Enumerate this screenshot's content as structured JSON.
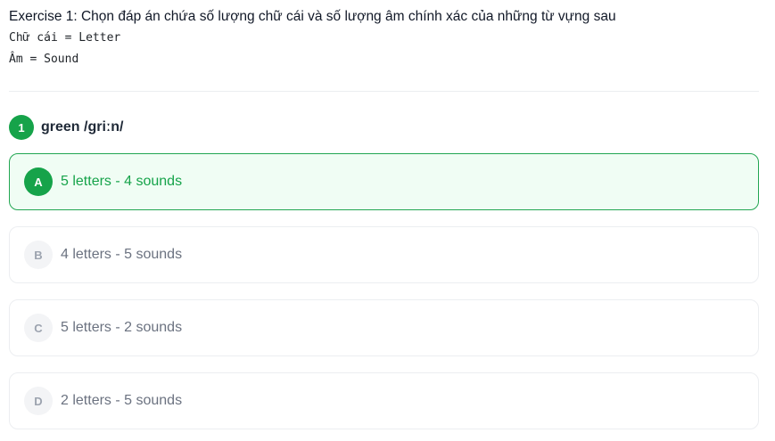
{
  "exercise": {
    "title": "Exercise 1: Chọn đáp án chứa số lượng chữ cái và số lượng âm chính xác của những từ vựng sau",
    "note_line1": "Chữ cái = Letter",
    "note_line2": "Âm = Sound"
  },
  "question": {
    "number": "1",
    "text": "green /griːn/"
  },
  "options": [
    {
      "letter": "A",
      "text": "5 letters - 4 sounds",
      "selected": true
    },
    {
      "letter": "B",
      "text": "4 letters - 5 sounds",
      "selected": false
    },
    {
      "letter": "C",
      "text": "5 letters - 2 sounds",
      "selected": false
    },
    {
      "letter": "D",
      "text": "2 letters - 5 sounds",
      "selected": false
    }
  ],
  "colors": {
    "accent": "#16a34a",
    "selected_bg": "#f0fdf4",
    "border": "#eceef1"
  }
}
